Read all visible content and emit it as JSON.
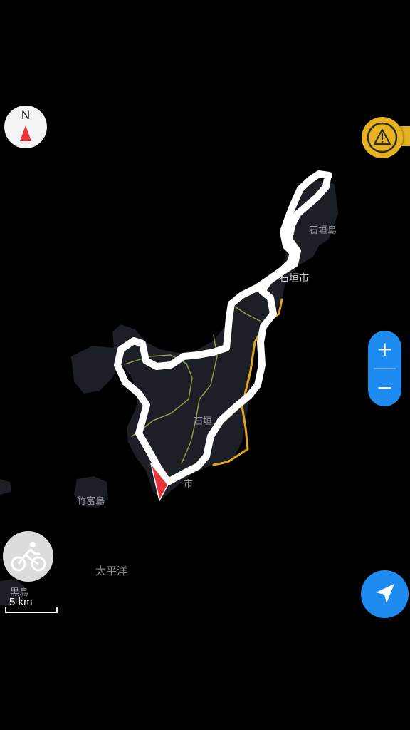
{
  "map": {
    "places": {
      "ishigaki_island": "石垣島",
      "ishigaki_city": "石垣市",
      "central_label": "石垣",
      "town_label": "市",
      "taketomi_island": "竹富島",
      "pacific_ocean": "太平洋",
      "kuroshima": "黒島"
    },
    "colors": {
      "land": "#1c1f26",
      "route": "#ffffff",
      "main_road": "#e3a521",
      "minor_road": "#8d9a4f",
      "marker": "#e8353a"
    }
  },
  "controls": {
    "compass": {
      "label": "N",
      "icon": "compass-needle-icon"
    },
    "warning": {
      "icon": "warning-triangle-icon",
      "color": "#e6b21f"
    },
    "zoom_in_label": "+",
    "zoom_out_label": "−",
    "activity": {
      "icon": "cycling-icon"
    },
    "locate": {
      "icon": "navigation-arrow-icon",
      "color": "#1e8bf0"
    }
  },
  "scale": {
    "label": "5 km"
  }
}
